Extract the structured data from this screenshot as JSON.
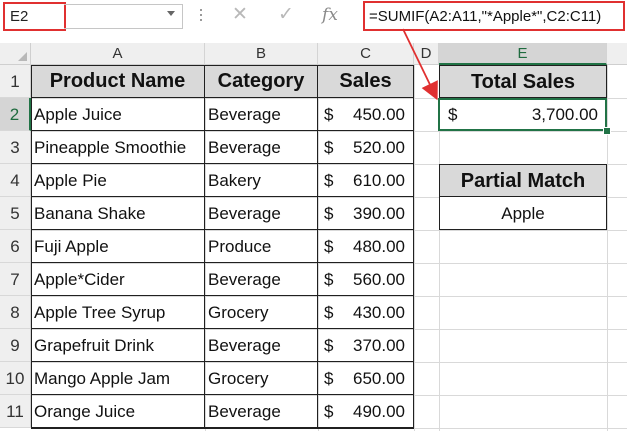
{
  "formula_bar": {
    "name_box": "E2",
    "fx_label": "fx",
    "formula": "=SUMIF(A2:A11,\"*Apple*\",C2:C11)"
  },
  "columns": [
    "A",
    "B",
    "C",
    "D",
    "E"
  ],
  "rows": [
    "1",
    "2",
    "3",
    "4",
    "5",
    "6",
    "7",
    "8",
    "9",
    "10",
    "11"
  ],
  "table": {
    "headers": [
      "Product Name",
      "Category",
      "Sales"
    ],
    "currency_symbol": "$",
    "rows": [
      {
        "product": "Apple Juice",
        "category": "Beverage",
        "sales": "450.00"
      },
      {
        "product": "Pineapple Smoothie",
        "category": "Beverage",
        "sales": "520.00"
      },
      {
        "product": "Apple Pie",
        "category": "Bakery",
        "sales": "610.00"
      },
      {
        "product": "Banana Shake",
        "category": "Beverage",
        "sales": "390.00"
      },
      {
        "product": "Fuji Apple",
        "category": "Produce",
        "sales": "480.00"
      },
      {
        "product": "Apple*Cider",
        "category": "Beverage",
        "sales": "560.00"
      },
      {
        "product": "Apple Tree Syrup",
        "category": "Grocery",
        "sales": "430.00"
      },
      {
        "product": "Grapefruit Drink",
        "category": "Beverage",
        "sales": "370.00"
      },
      {
        "product": "Mango Apple Jam",
        "category": "Grocery",
        "sales": "650.00"
      },
      {
        "product": "Orange Juice",
        "category": "Beverage",
        "sales": "490.00"
      }
    ]
  },
  "total_sales": {
    "header": "Total Sales",
    "currency_symbol": "$",
    "value": "3,700.00"
  },
  "partial_match": {
    "header": "Partial Match",
    "value": "Apple"
  },
  "colors": {
    "selection": "#217346",
    "highlight": "#e03030",
    "header_fill": "#d9d9d9"
  }
}
